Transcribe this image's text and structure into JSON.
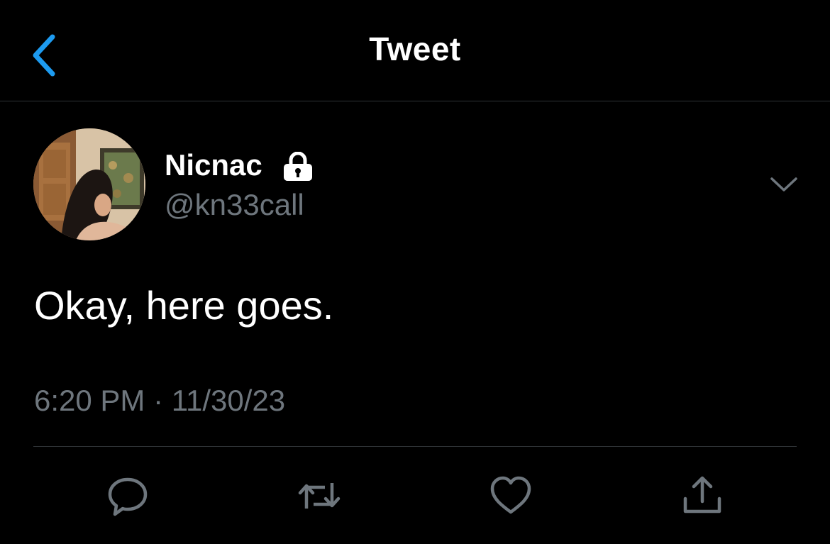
{
  "header": {
    "title": "Tweet",
    "back_icon": "chevron-left-icon",
    "accent_color": "#1d9bf0"
  },
  "tweet": {
    "author": {
      "display_name": "Nicnac",
      "handle": "@kn33call",
      "protected": true,
      "lock_icon": "lock-icon"
    },
    "text": "Okay, here goes.",
    "timestamp": "6:20 PM · 11/30/23",
    "more_icon": "chevron-down-icon"
  },
  "actions": [
    {
      "name": "reply",
      "icon": "reply-icon"
    },
    {
      "name": "retweet",
      "icon": "retweet-icon"
    },
    {
      "name": "like",
      "icon": "heart-icon"
    },
    {
      "name": "share",
      "icon": "share-icon"
    }
  ],
  "colors": {
    "background": "#000000",
    "text_primary": "#ffffff",
    "text_secondary": "#6e767d",
    "divider": "#2f3336"
  }
}
